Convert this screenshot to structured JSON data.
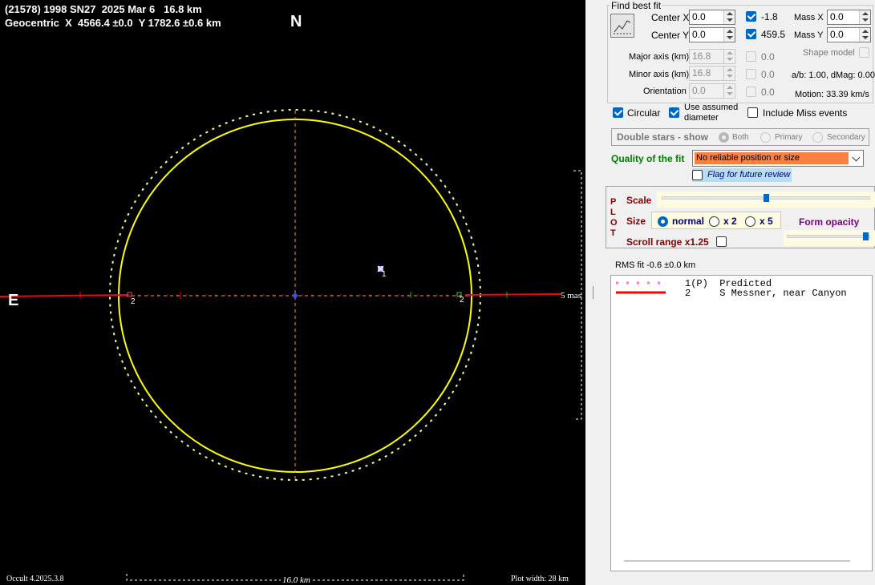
{
  "plot": {
    "title_line1": "(21578) 1998 SN27  2025 Mar 6   16.8 km",
    "title_line2": "Geocentric  X  4566.4 ±0.0  Y 1782.6 ±0.6 km",
    "north_label": "N",
    "east_label": "E",
    "scale_label": "5 mas",
    "version": "Occult 4.2025.3.8",
    "bottom_scale": "16.0 km",
    "plot_width": "Plot width: 28 km",
    "chord_numbers": {
      "left": "2",
      "right": "2",
      "predicted": "1"
    },
    "colors": {
      "ellipse": "#ffff00",
      "chord": "#ff0000",
      "axes": "#f0a040",
      "background": "#000000"
    }
  },
  "panel": {
    "find_best_fit": "Find best fit",
    "center_x": {
      "label": "Center X",
      "value": "0.0"
    },
    "center_y": {
      "label": "Center Y",
      "value": "0.0"
    },
    "check_x": {
      "value": "-1.8",
      "checked": true
    },
    "check_y": {
      "value": "459.5",
      "checked": true
    },
    "mass_x": {
      "label": "Mass X",
      "value": "0.0"
    },
    "mass_y": {
      "label": "Mass Y",
      "value": "0.0"
    },
    "major_axis": {
      "label": "Major axis (km)",
      "value": "16.8",
      "check_value": "0.0"
    },
    "minor_axis": {
      "label": "Minor axis (km)",
      "value": "16.8",
      "check_value": "0.0"
    },
    "orientation": {
      "label": "Orientation",
      "value": "0.0",
      "check_value": "0.0"
    },
    "shape_model": "Shape model",
    "ab_dmag": "a/b: 1.00, dMag: 0.00",
    "motion": "Motion: 33.39 km/s",
    "circular": "Circular",
    "use_assumed_l1": "Use assumed",
    "use_assumed_l2": "diameter",
    "include_miss": "Include Miss events",
    "double_stars": "Double stars - show",
    "double_options": [
      "Both",
      "Primary",
      "Secondary"
    ],
    "quality_label": "Quality of the fit",
    "quality_value": "No reliable position or size",
    "flag_future": "Flag for future review",
    "plot_letters": [
      "P",
      "L",
      "O",
      "T"
    ],
    "scale_label": "Scale",
    "size_label": "Size",
    "size_options": [
      "normal",
      "x 2",
      "x 5"
    ],
    "form_opacity": "Form opacity",
    "scroll_range": "Scroll range x1.25",
    "rms_fit": "RMS fit -0.6 ±0.0 km",
    "legend": [
      {
        "line": "1(P)  Predicted",
        "style": "dotted",
        "color": "#ff77cc"
      },
      {
        "line": "2     S Messner, near Canyon",
        "style": "solid",
        "color": "#ff0000"
      }
    ],
    "scale_slider_fraction": 0.5,
    "opacity_slider_fraction": 1.0
  }
}
